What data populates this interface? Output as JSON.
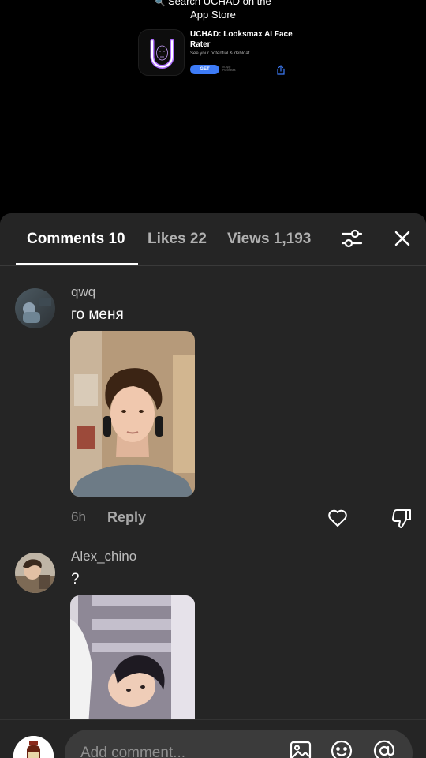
{
  "ad": {
    "search_text": "Search UCHAD on the",
    "store_text": "App Store",
    "app_name": "UCHAD: Looksmax AI Face Rater",
    "tagline": "See your potential & debloat",
    "get_label": "GET",
    "get_sub": "In-App Purchases",
    "icons": {
      "search": "magnifier-icon",
      "app": "uchad-u-logo",
      "share": "share-icon"
    },
    "colors": {
      "get": "#3d7bf7",
      "logo": "#b070ff"
    }
  },
  "tabs": [
    {
      "label": "Comments 10",
      "active": true
    },
    {
      "label": "Likes 22",
      "active": false
    },
    {
      "label": "Views 1,193",
      "active": false
    }
  ],
  "header_icons": {
    "filter": "sliders-icon",
    "close": "close-icon"
  },
  "comments": [
    {
      "username": "qwq",
      "text": "го меня",
      "time": "6h",
      "reply": "Reply",
      "has_photo": true
    },
    {
      "username": "Alex_chino",
      "text": "?",
      "has_photo": true
    }
  ],
  "composer": {
    "placeholder": "Add comment...",
    "icons": [
      "image-icon",
      "emoji-icon",
      "at-mention-icon"
    ]
  }
}
